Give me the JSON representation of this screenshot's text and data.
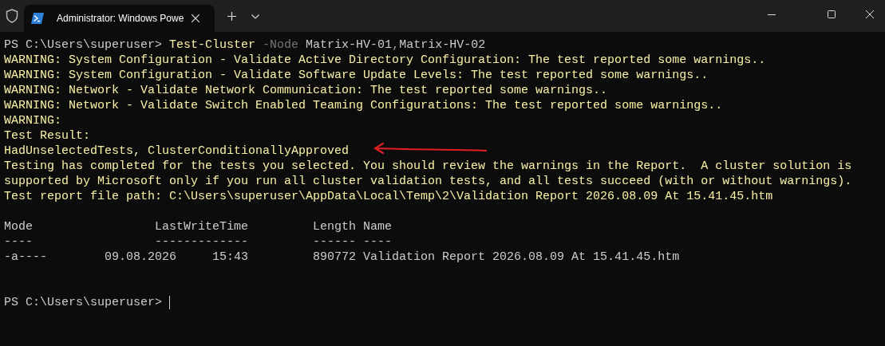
{
  "window": {
    "tab_title": "Administrator: Windows Powe"
  },
  "lines": [
    {
      "kind": "text",
      "segments": [
        {
          "kind": "prompt",
          "text": "PS C:\\Users\\superuser> "
        },
        {
          "kind": "cmdlet",
          "text": "Test-Cluster "
        },
        {
          "kind": "parameter",
          "text": "-Node "
        },
        {
          "kind": "argument",
          "text": "Matrix-HV-01"
        },
        {
          "kind": "operator",
          "text": ","
        },
        {
          "kind": "argument",
          "text": "Matrix-HV-02"
        }
      ]
    },
    {
      "kind": "text",
      "segments": [
        {
          "kind": "warning",
          "text": "WARNING: System Configuration - Validate Active Directory Configuration: The test reported some warnings.."
        }
      ]
    },
    {
      "kind": "text",
      "segments": [
        {
          "kind": "warning",
          "text": "WARNING: System Configuration - Validate Software Update Levels: The test reported some warnings.."
        }
      ]
    },
    {
      "kind": "text",
      "segments": [
        {
          "kind": "warning",
          "text": "WARNING: Network - Validate Network Communication: The test reported some warnings.."
        }
      ]
    },
    {
      "kind": "text",
      "segments": [
        {
          "kind": "warning",
          "text": "WARNING: Network - Validate Switch Enabled Teaming Configurations: The test reported some warnings.."
        }
      ]
    },
    {
      "kind": "text",
      "segments": [
        {
          "kind": "warning",
          "text": "WARNING:"
        }
      ]
    },
    {
      "kind": "text",
      "segments": [
        {
          "kind": "warning",
          "text": "Test Result:"
        }
      ]
    },
    {
      "kind": "text",
      "segments": [
        {
          "kind": "warning",
          "text": "HadUnselectedTests, ClusterConditionallyApproved"
        }
      ]
    },
    {
      "kind": "text",
      "segments": [
        {
          "kind": "warning",
          "text": "Testing has completed for the tests you selected. You should review the warnings in the Report.  A cluster solution is"
        }
      ]
    },
    {
      "kind": "text",
      "segments": [
        {
          "kind": "warning",
          "text": "supported by Microsoft only if you run all cluster validation tests, and all tests succeed (with or without warnings)."
        }
      ]
    },
    {
      "kind": "text",
      "segments": [
        {
          "kind": "warning",
          "text": "Test report file path: C:\\Users\\superuser\\AppData\\Local\\Temp\\2\\Validation Report 2026.08.09 At 15.41.45.htm"
        }
      ]
    },
    {
      "kind": "blank"
    },
    {
      "kind": "text",
      "segments": [
        {
          "kind": "plain",
          "text": "Mode                 LastWriteTime         Length Name"
        }
      ]
    },
    {
      "kind": "text",
      "segments": [
        {
          "kind": "plain",
          "text": "----                 -------------         ------ ----"
        }
      ]
    },
    {
      "kind": "text",
      "segments": [
        {
          "kind": "plain",
          "text": "-a----        09.08.2026     15:43         890772 Validation Report 2026.08.09 At 15.41.45.htm"
        }
      ]
    },
    {
      "kind": "blank"
    },
    {
      "kind": "blank"
    },
    {
      "kind": "prompt",
      "segments": [
        {
          "kind": "prompt",
          "text": "PS C:\\Users\\superuser> "
        }
      ]
    }
  ]
}
